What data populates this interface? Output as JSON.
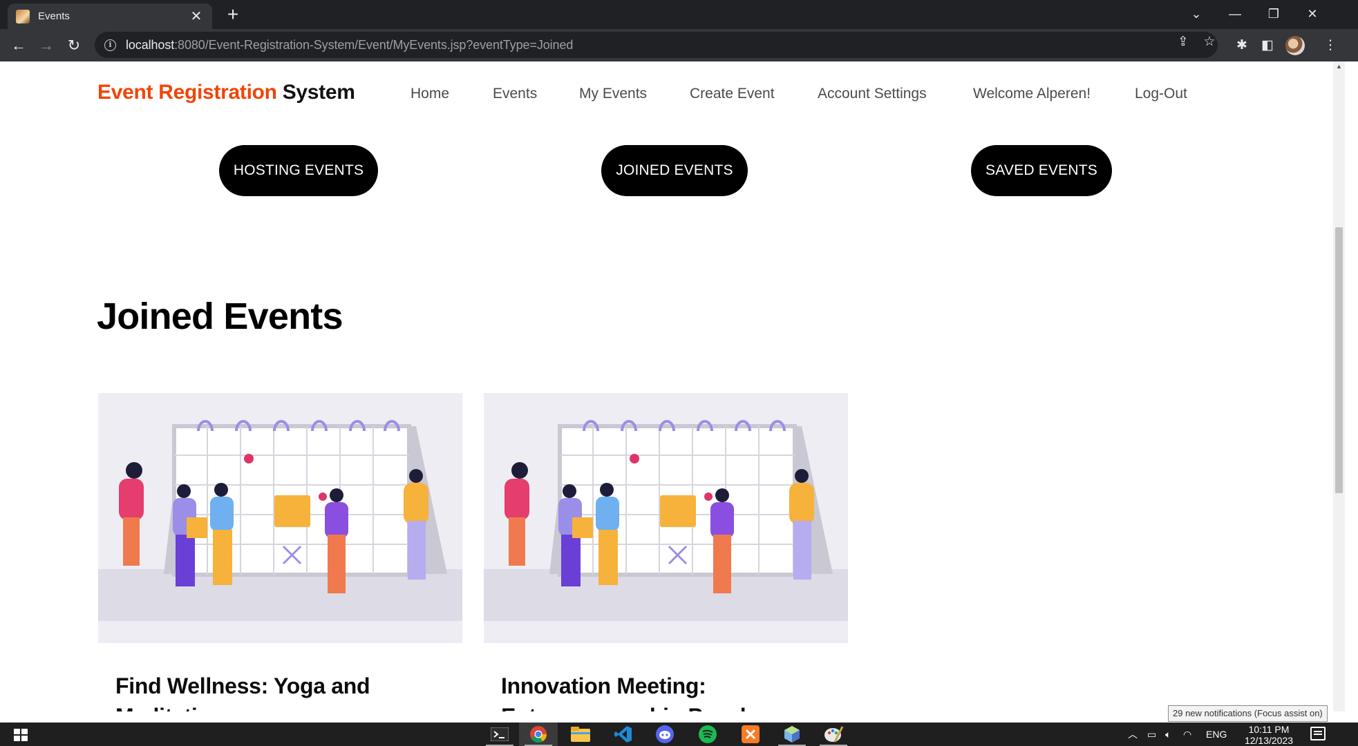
{
  "browser": {
    "tab_title": "Events",
    "tab_close": "✕",
    "new_tab": "+",
    "url_host": "localhost",
    "url_rest": ":8080/Event-Registration-System/Event/MyEvents.jsp?eventType=Joined"
  },
  "header": {
    "brand_accent": "Event Registration",
    "brand_rest": " System",
    "nav": [
      "Home",
      "Events",
      "My Events",
      "Create Event",
      "Account Settings",
      "Welcome Alperen!",
      "Log-Out"
    ]
  },
  "filters": {
    "hosting": "HOSTING EVENTS",
    "joined": "JOINED EVENTS",
    "saved": "SAVED EVENTS"
  },
  "section_title": "Joined Events",
  "events": [
    {
      "title": "Find Wellness: Yoga and Meditation"
    },
    {
      "title": "Innovation Meeting: Entrepreneurship Panel"
    }
  ],
  "notification_toast": "29 new notifications (Focus assist on)",
  "taskbar": {
    "language": "ENG",
    "time": "10:11 PM",
    "date": "12/13/2023"
  },
  "colors": {
    "brand_accent": "#f24405",
    "pill_bg": "#000000",
    "illustration_bg": "#eeedf4"
  }
}
